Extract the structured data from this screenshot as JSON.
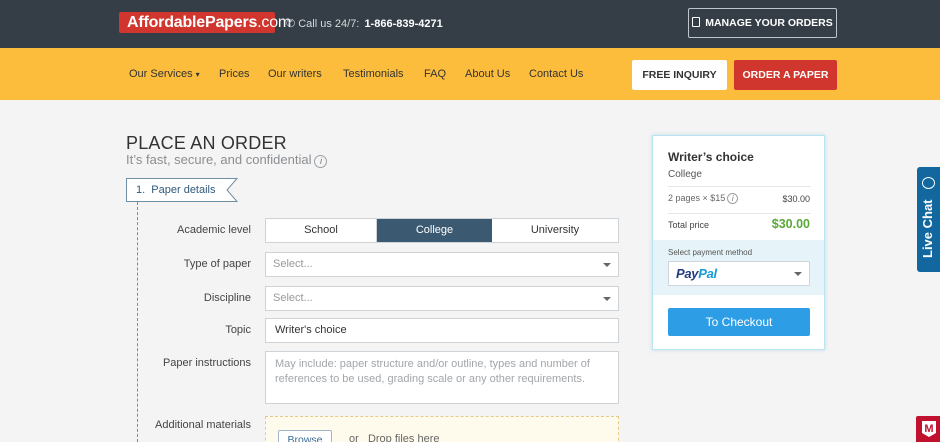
{
  "header": {
    "logo_bold": "AffordablePapers",
    "logo_light": ".com",
    "phone_label": "Call us 24/7:",
    "phone_number": "1-866-839-4271",
    "manage_orders": "MANAGE YOUR ORDERS"
  },
  "nav": {
    "items": [
      "Our Services",
      "Prices",
      "Our writers",
      "Testimonials",
      "FAQ",
      "About Us",
      "Contact Us"
    ],
    "free_inquiry": "FREE INQUIRY",
    "order_paper": "ORDER A PAPER"
  },
  "main": {
    "title": "PLACE AN ORDER",
    "subtitle": "It’s fast, secure, and confidential",
    "step": "1.  Paper details"
  },
  "form": {
    "academic_level_label": "Academic level",
    "levels": [
      "School",
      "College",
      "University"
    ],
    "selected_level": "College",
    "type_label": "Type of paper",
    "type_placeholder": "Select...",
    "discipline_label": "Discipline",
    "discipline_placeholder": "Select...",
    "topic_label": "Topic",
    "topic_value": "Writer's choice",
    "instructions_label": "Paper instructions",
    "instructions_placeholder": "May include: paper structure and/or outline, types and number of references to be used, grading scale or any other requirements.",
    "materials_label": "Additional materials",
    "browse": "Browse",
    "drop_text": "or   Drop files here"
  },
  "summary": {
    "title": "Writer’s choice",
    "level": "College",
    "pages_text": "2 pages × $15",
    "pages_price": "$30.00",
    "total_label": "Total price",
    "total_value": "$30.00",
    "payment_label": "Select payment method",
    "payment_pay": "Pay",
    "payment_pal": "Pal",
    "checkout": "To Checkout"
  },
  "widgets": {
    "live_chat": "Live Chat",
    "badge_letter": "M"
  },
  "colors": {
    "topbar": "#353e46",
    "navbar": "#fbbd3b",
    "accent_red": "#d0362d",
    "selected_segment": "#3b5a72",
    "checkout_blue": "#2d9ee6",
    "total_green": "#5aa83a",
    "live_chat_blue": "#12679e"
  },
  "icons": {
    "phone": "phone-icon",
    "manage": "document-icon",
    "services": "chevron-down-icon",
    "info": "info-icon",
    "chat": "chat-bubble-icon"
  }
}
